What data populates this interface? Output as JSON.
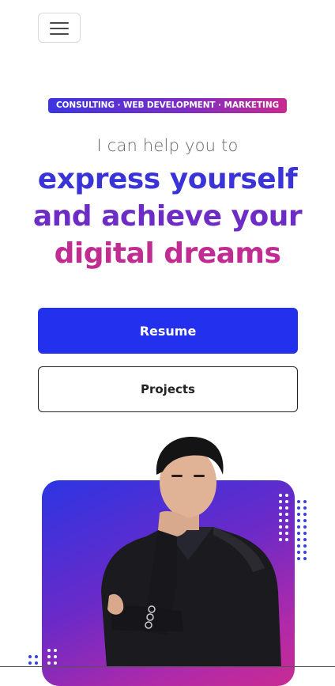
{
  "nav": {
    "menu_icon": "hamburger-menu-icon"
  },
  "hero": {
    "badge": "CONSULTING · WEB DEVELOPMENT · MARKETING",
    "intro": "I can help you to",
    "headline_line1": "express yourself",
    "headline_line2": "and achieve your",
    "headline_line3": "digital dreams"
  },
  "actions": {
    "resume_label": "Resume",
    "projects_label": "Projects"
  },
  "colors": {
    "primary_blue": "#2331ef",
    "gradient_start": "#3a34d6",
    "gradient_mid": "#6d2cc6",
    "gradient_end": "#c02c92"
  }
}
